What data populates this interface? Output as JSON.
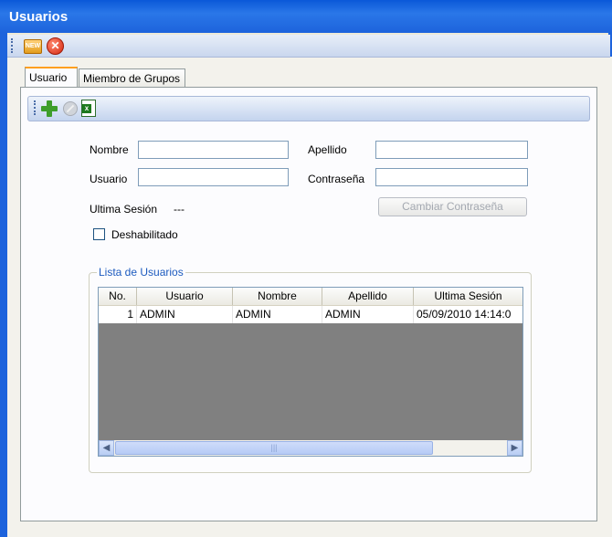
{
  "window": {
    "title": "Usuarios"
  },
  "main_toolbar": {
    "new_icon_text": "NEW"
  },
  "tabs": [
    {
      "label": "Usuario",
      "active": true
    },
    {
      "label": "Miembro de Grupos",
      "active": false
    }
  ],
  "form": {
    "nombre_label": "Nombre",
    "nombre_value": "",
    "apellido_label": "Apellido",
    "apellido_value": "",
    "usuario_label": "Usuario",
    "usuario_value": "",
    "contrasena_label": "Contraseña",
    "contrasena_value": "",
    "ultima_sesion_label": "Ultima Sesión",
    "ultima_sesion_value": "---",
    "cambiar_contrasena_button": "Cambiar Contraseña",
    "deshabilitado_label": "Deshabilitado",
    "deshabilitado_checked": false
  },
  "user_list": {
    "group_title": "Lista de Usuarios",
    "columns": [
      "No.",
      "Usuario",
      "Nombre",
      "Apellido",
      "Ultima Sesión"
    ],
    "rows": [
      [
        "1",
        "ADMIN",
        "ADMIN",
        "ADMIN",
        "05/09/2010 14:14:0"
      ]
    ]
  },
  "colors": {
    "title_bar": "#0a58d8",
    "accent_tab": "#ff9f1e",
    "group_title": "#1d5bbf"
  }
}
